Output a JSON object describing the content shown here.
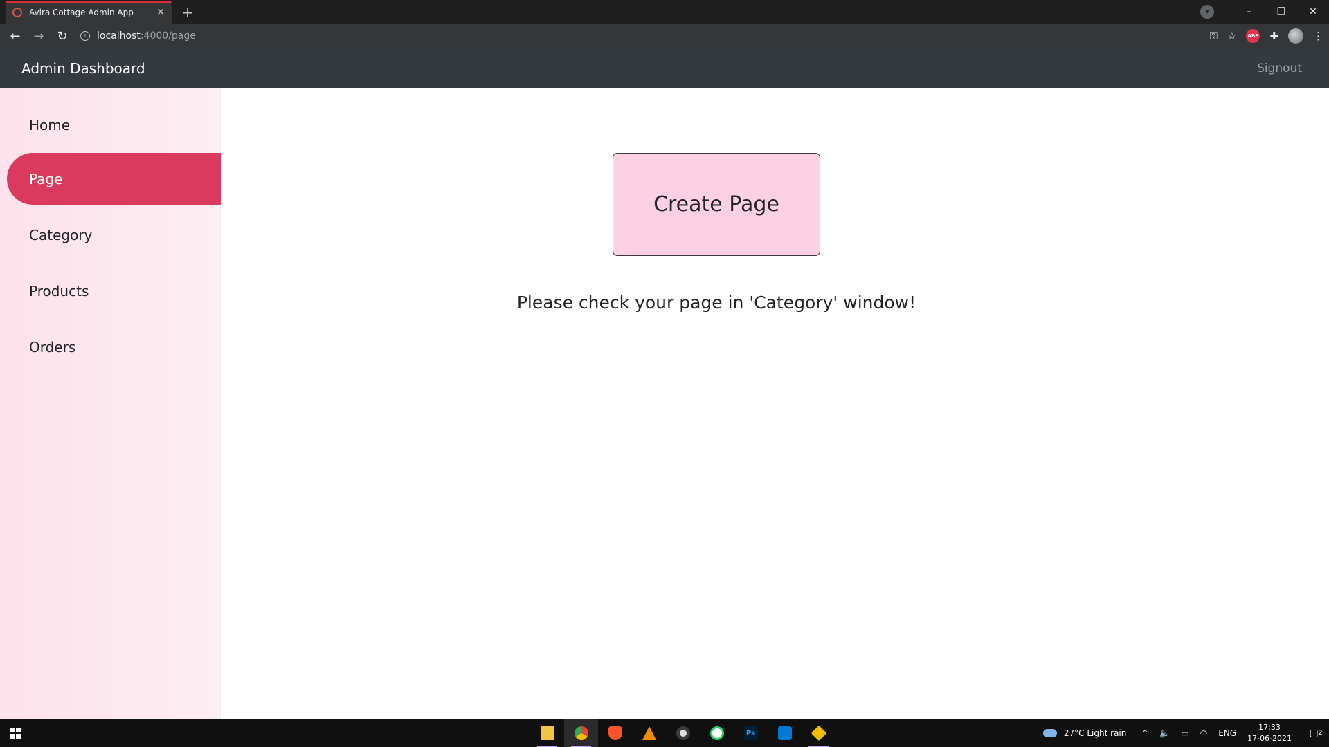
{
  "browser": {
    "tab_title": "Avira Cottage Admin App",
    "tab_close": "✕",
    "new_tab": "+",
    "url_host": "localhost",
    "url_path": ":4000/page",
    "window_controls": {
      "minimize": "–",
      "restore": "❐",
      "close": "✕"
    },
    "extension_abp": "ABP"
  },
  "header": {
    "brand": "Admin Dashboard",
    "signout": "Signout"
  },
  "sidebar": {
    "items": [
      {
        "label": "Home"
      },
      {
        "label": "Page"
      },
      {
        "label": "Category"
      },
      {
        "label": "Products"
      },
      {
        "label": "Orders"
      }
    ],
    "active_index": 1
  },
  "main": {
    "create_button": "Create Page",
    "hint": "Please check your page in 'Category' window!"
  },
  "taskbar": {
    "apps": [
      "file-explorer",
      "chrome",
      "brave",
      "vlc",
      "obs",
      "whatsapp",
      "photoshop",
      "vscode",
      "git"
    ],
    "photoshop_label": "Ps",
    "weather": "27°C  Light rain",
    "lang": "ENG",
    "time": "17:33",
    "date": "17-06-2021",
    "notifications": "2"
  },
  "colors": {
    "header_bg": "#343a40",
    "sidebar_active": "#d93a5e",
    "create_button_bg": "#fdd0e3"
  }
}
